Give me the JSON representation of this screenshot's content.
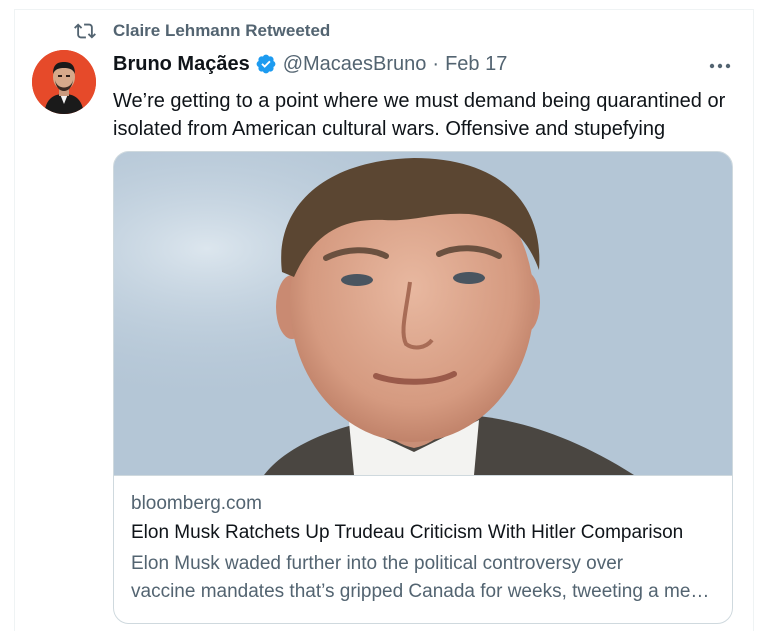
{
  "retweet": {
    "label": "Claire Lehmann Retweeted",
    "icon": "retweet-icon"
  },
  "author": {
    "display_name": "Bruno Maçães",
    "handle": "@MacaesBruno",
    "separator": "·",
    "date": "Feb 17",
    "verified": true,
    "avatar_color": "#e64a2a"
  },
  "tweet": {
    "text": "We’re getting to a point where we must demand being quarantined or isolated from American cultural wars. Offensive and stupefying"
  },
  "card": {
    "domain": "bloomberg.com",
    "title": "Elon Musk Ratchets Up Trudeau Criticism With Hitler Comparison",
    "description_line1": "Elon Musk waded further into the political controversy over",
    "description_line2": "vaccine mandates that’s gripped Canada for weeks, tweeting a meme"
  },
  "colors": {
    "text_primary": "#0f1419",
    "text_secondary": "#536471",
    "verified_blue": "#1d9bf0",
    "border": "#cfd9de"
  }
}
